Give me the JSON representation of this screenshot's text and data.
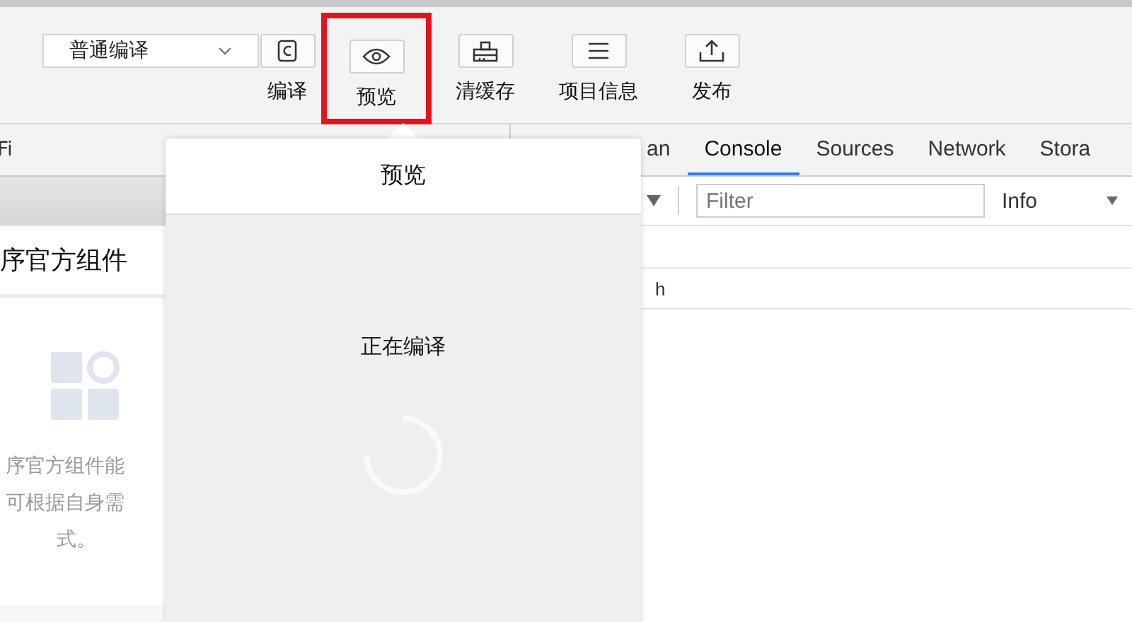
{
  "toolbar": {
    "mode_select": {
      "value": "普通编译"
    },
    "tools": [
      {
        "kind": "compile",
        "label": "编译",
        "highlighted": false
      },
      {
        "kind": "preview",
        "label": "预览",
        "highlighted": true
      },
      {
        "kind": "cache",
        "label": "清缓存",
        "highlighted": false
      },
      {
        "kind": "info",
        "label": "项目信息",
        "highlighted": false
      },
      {
        "kind": "publish",
        "label": "发布",
        "highlighted": false
      }
    ]
  },
  "left_tab": {
    "label": "Fi"
  },
  "devtools": {
    "tabs": [
      {
        "label": "an",
        "selected": false
      },
      {
        "label": "Console",
        "selected": true
      },
      {
        "label": "Sources",
        "selected": false
      },
      {
        "label": "Network",
        "selected": false
      },
      {
        "label": "Stora",
        "selected": false
      }
    ],
    "filter": {
      "placeholder": "Filter"
    },
    "level_select": {
      "value": "Info"
    },
    "log_lines": [
      "h"
    ]
  },
  "component_panel": {
    "title": "序官方组件",
    "description_lines": [
      "序官方组件能",
      "可根据自身需",
      "式。"
    ]
  },
  "popup": {
    "title": "预览",
    "status": "正在编译"
  }
}
